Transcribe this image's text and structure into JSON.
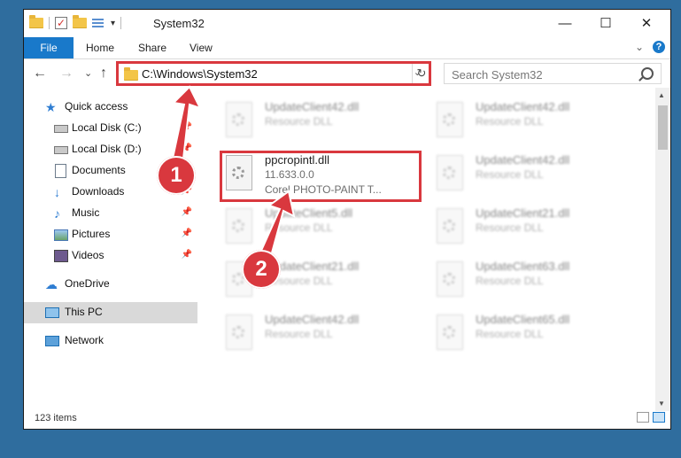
{
  "window": {
    "title": "System32",
    "controls": {
      "minimize": "—",
      "maximize": "☐",
      "close": "✕"
    }
  },
  "ribbon": {
    "tabs": [
      "File",
      "Home",
      "Share",
      "View"
    ]
  },
  "address_bar": {
    "path": "C:\\Windows\\System32",
    "dropdown": "⌄",
    "refresh": "↻"
  },
  "search": {
    "placeholder": "Search System32"
  },
  "nav_buttons": {
    "back": "←",
    "forward": "→",
    "recent": "⌄",
    "up": "↑"
  },
  "sidebar": {
    "items": [
      {
        "label": "Quick access",
        "icon": "star-icon",
        "pinned": false
      },
      {
        "label": "Local Disk (C:)",
        "icon": "drive-icon",
        "pinned": true
      },
      {
        "label": "Local Disk (D:)",
        "icon": "drive-icon",
        "pinned": true
      },
      {
        "label": "Documents",
        "icon": "document-icon",
        "pinned": true
      },
      {
        "label": "Downloads",
        "icon": "download-icon",
        "pinned": true
      },
      {
        "label": "Music",
        "icon": "music-icon",
        "pinned": true
      },
      {
        "label": "Pictures",
        "icon": "pictures-icon",
        "pinned": true
      },
      {
        "label": "Videos",
        "icon": "videos-icon",
        "pinned": true
      },
      {
        "label": "OneDrive",
        "icon": "cloud-icon",
        "pinned": false
      },
      {
        "label": "This PC",
        "icon": "pc-icon",
        "pinned": false,
        "selected": true
      },
      {
        "label": "Network",
        "icon": "network-icon",
        "pinned": false
      }
    ]
  },
  "files": {
    "highlighted": {
      "name": "ppcropintl.dll",
      "version": "11.633.0.0",
      "description": "Corel PHOTO-PAINT T..."
    },
    "left_column": [
      {
        "name": "UpdateClient42.dll",
        "type": "Resource DLL"
      },
      {
        "name": "UpdateClient5.dll",
        "type": "Resource DLL"
      },
      {
        "name": "UpdateClient21.dll",
        "type": "Resource DLL"
      },
      {
        "name": "UpdateClient42.dll",
        "type": "Resource DLL"
      }
    ],
    "right_column": [
      {
        "name": "UpdateClient42.dll",
        "type": "Resource DLL"
      },
      {
        "name": "UpdateClient42.dll",
        "type": "Resource DLL"
      },
      {
        "name": "UpdateClient21.dll",
        "type": "Resource DLL"
      },
      {
        "name": "UpdateClient63.dll",
        "type": "Resource DLL"
      },
      {
        "name": "UpdateClient65.dll",
        "type": "Resource DLL"
      }
    ]
  },
  "status": {
    "item_count": "123 items"
  },
  "annotations": {
    "step1": "1",
    "step2": "2",
    "color": "#d9383e"
  }
}
